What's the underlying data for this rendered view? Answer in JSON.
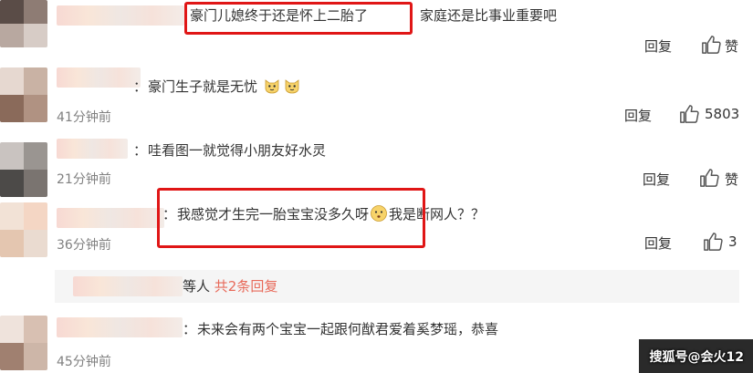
{
  "comments": [
    {
      "text_highlight": "豪门儿媳终于还是怀上二胎了",
      "text_rest": "家庭还是比事业重要吧",
      "reply_label": "回复",
      "like_label": "赞"
    },
    {
      "prefix": "：",
      "text": "豪门生子就是无忧",
      "emoji": [
        "cat-face-emoji",
        "cat-face-emoji"
      ],
      "time": "41分钟前",
      "reply_label": "回复",
      "like_count": "5803"
    },
    {
      "prefix": "：",
      "text": "哇看图一就觉得小朋友好水灵",
      "time": "21分钟前",
      "reply_label": "回复",
      "like_label": "赞"
    },
    {
      "prefix": "：",
      "text_before": "我感觉才生完一胎宝宝没多久呀",
      "emoji": [
        "thinking-face-emoji"
      ],
      "text_after": "我是断网人？？",
      "time": "36分钟前",
      "reply_label": "回复",
      "like_count": "3"
    },
    {
      "prefix": "：",
      "text": "未来会有两个宝宝一起跟何猷君爱着奚梦瑶，恭喜",
      "time": "45分钟前"
    }
  ],
  "sub_replies": {
    "suffix": "等人",
    "link": "共2条回复"
  },
  "watermark": "搜狐号@会火12",
  "colors": {
    "highlight_box": "#e01616",
    "reply_link": "#e86a5a",
    "time_gray": "#808080"
  }
}
